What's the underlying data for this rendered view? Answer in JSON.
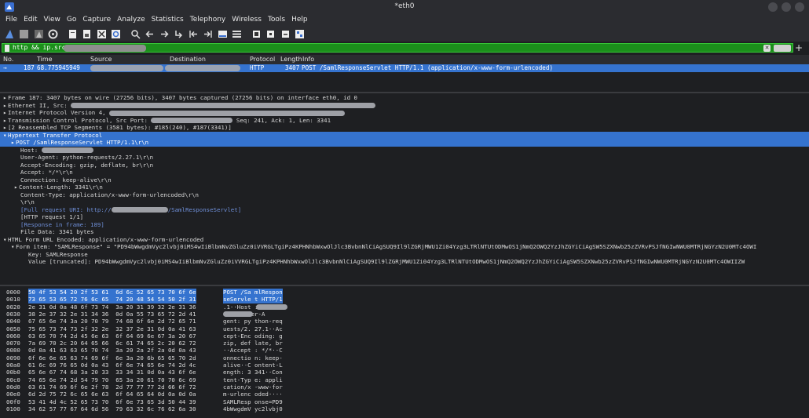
{
  "window": {
    "title": "*eth0"
  },
  "menu": [
    "File",
    "Edit",
    "View",
    "Go",
    "Capture",
    "Analyze",
    "Statistics",
    "Telephony",
    "Wireless",
    "Tools",
    "Help"
  ],
  "toolbar_icons": [
    "shark-fin-start-icon",
    "stop-square-icon",
    "restart-shark-icon",
    "options-gear-icon",
    "open-file-icon",
    "save-file-icon",
    "close-file-icon",
    "reload-icon",
    "search-icon",
    "back-arrow-icon",
    "forward-arrow-icon",
    "go-to-packet-icon",
    "first-packet-icon",
    "last-packet-icon",
    "autoscroll-icon",
    "colorize-icon",
    "zoom-in-icon",
    "zoom-out-icon",
    "normal-size-icon",
    "resize-columns-icon"
  ],
  "filter": {
    "text": "http && ip.src=="
  },
  "packet_list": {
    "columns": [
      "No.",
      "Time",
      "Source",
      "Destination",
      "Protocol",
      "Length",
      "Info"
    ],
    "rows": [
      {
        "no": "187",
        "time": "68.775945949",
        "protocol": "HTTP",
        "length": "3407",
        "info": "POST /SamlResponseServlet HTTP/1.1  (application/x-www-form-urlencoded)"
      }
    ]
  },
  "details": {
    "frame": "Frame 187: 3407 bytes on wire (27256 bits), 3407 bytes captured (27256 bits) on interface eth0, id 0",
    "ethernet": "Ethernet II, Src: ",
    "ip": "Internet Protocol Version 4, ",
    "tcp": "Transmission Control Protocol, Src Port: ",
    "tcp_tail": "Seq: 241, Ack: 1, Len: 3341",
    "reassembled": "[2 Reassembled TCP Segments (3581 bytes): #185(240), #187(3341)]",
    "http": "Hypertext Transfer Protocol",
    "http_lines": {
      "post": "POST /SamlResponseServlet HTTP/1.1\\r\\n",
      "host": "Host: ",
      "ua": "User-Agent: python-requests/2.27.1\\r\\n",
      "ae": "Accept-Encoding: gzip, deflate, br\\r\\n",
      "accept": "Accept: */*\\r\\n",
      "conn": "Connection: keep-alive\\r\\n",
      "cl": "Content-Length: 3341\\r\\n",
      "ct": "Content-Type: application/x-www-form-urlencoded\\r\\n",
      "crlf": "\\r\\n",
      "full_uri_a": "[Full request URI: http://",
      "full_uri_b": "/SamlResponseServlet]",
      "req": "[HTTP request 1/1]",
      "resp": "[Response in frame: 189]",
      "filedata": "File Data: 3341 bytes"
    },
    "form": "HTML Form URL Encoded: application/x-www-form-urlencoded",
    "form_item": "Form item: \"SAMLResponse\" = \"PD94bWwgdmVyc2lvbj0iMS4wIiBlbmNvZGluZz0iVVRGLTgiPz4KPHNhbWxwOlJlc3BvbnNlCiAgSUQ9Il9lZGRjMWU1Zi04Yzg3LTRlNTUtODMwOS1jNmQ2OWQ2YzJhZGYiCiAgSW5SZXNwb25zZVRvPSJfNGIwNWU0MTRjNGYzN2U0MTc4OWI",
    "key": "Key: SAMLResponse",
    "value": "Value [truncated]: PD94bWwgdmVyc2lvbj0iMS4wIiBlbmNvZGluZz0iVVRGLTgiPz4KPHNhbWxwOlJlc3BvbnNlCiAgSUQ9Il9lZGRjMWU1Zi04Yzg3LTRlNTUtODMwOS1jNmQ2OWQ2YzJhZGYiCiAgSW5SZXNwb25zZVRvPSJfNGIwNWU0MTRjNGYzN2U0MTc4OWIIZW"
  },
  "hex": [
    {
      "off": "0000",
      "bytes": "50 4f 53 54 20 2f 53 61  6d 6c 52 65 73 70 6f 6e",
      "ascii": "POST /Sa mlRespon"
    },
    {
      "off": "0010",
      "bytes": "73 65 53 65 72 76 6c 65  74 20 48 54 54 50 2f 31",
      "ascii": "seServle t HTTP/1"
    },
    {
      "off": "0020",
      "bytes": "2e 31 0d 0a 48 6f 73 74  3a 20 31 39 32 2e 31 36",
      "ascii": ".1··Host : "
    },
    {
      "off": "0030",
      "bytes": "38 2e 37 32 2e 31 34 36  0d 0a 55 73 65 72 2d 41",
      "ascii": "    ··User-A"
    },
    {
      "off": "0040",
      "bytes": "67 65 6e 74 3a 20 70 79  74 68 6f 6e 2d 72 65 71",
      "ascii": "gent: py thon-req"
    },
    {
      "off": "0050",
      "bytes": "75 65 73 74 73 2f 32 2e  32 37 2e 31 0d 0a 41 63",
      "ascii": "uests/2. 27.1··Ac"
    },
    {
      "off": "0060",
      "bytes": "63 65 70 74 2d 45 6e 63  6f 64 69 6e 67 3a 20 67",
      "ascii": "cept-Enc oding: g"
    },
    {
      "off": "0070",
      "bytes": "7a 69 70 2c 20 64 65 66  6c 61 74 65 2c 20 62 72",
      "ascii": "zip, def late, br"
    },
    {
      "off": "0080",
      "bytes": "0d 0a 41 63 63 65 70 74  3a 20 2a 2f 2a 0d 0a 43",
      "ascii": "··Accept : */*··C"
    },
    {
      "off": "0090",
      "bytes": "6f 6e 6e 65 63 74 69 6f  6e 3a 20 6b 65 65 70 2d",
      "ascii": "onnectio n: keep-"
    },
    {
      "off": "00a0",
      "bytes": "61 6c 69 76 65 0d 0a 43  6f 6e 74 65 6e 74 2d 4c",
      "ascii": "alive··C ontent-L"
    },
    {
      "off": "00b0",
      "bytes": "65 6e 67 74 68 3a 20 33  33 34 31 0d 0a 43 6f 6e",
      "ascii": "ength: 3 341··Con"
    },
    {
      "off": "00c0",
      "bytes": "74 65 6e 74 2d 54 79 70  65 3a 20 61 70 70 6c 69",
      "ascii": "tent-Typ e: appli"
    },
    {
      "off": "00d0",
      "bytes": "63 61 74 69 6f 6e 2f 78  2d 77 77 77 2d 66 6f 72",
      "ascii": "cation/x -www-for"
    },
    {
      "off": "00e0",
      "bytes": "6d 2d 75 72 6c 65 6e 63  6f 64 65 64 0d 0a 0d 0a",
      "ascii": "m-urlenc oded····"
    },
    {
      "off": "00f0",
      "bytes": "53 41 4d 4c 52 65 73 70  6f 6e 73 65 3d 50 44 39",
      "ascii": "SAMLResp onse=PD9"
    },
    {
      "off": "0100",
      "bytes": "34 62 57 77 67 64 6d 56  79 63 32 6c 76 62 6a 30",
      "ascii": "4bWwgdmV yc2lvbj0"
    }
  ]
}
